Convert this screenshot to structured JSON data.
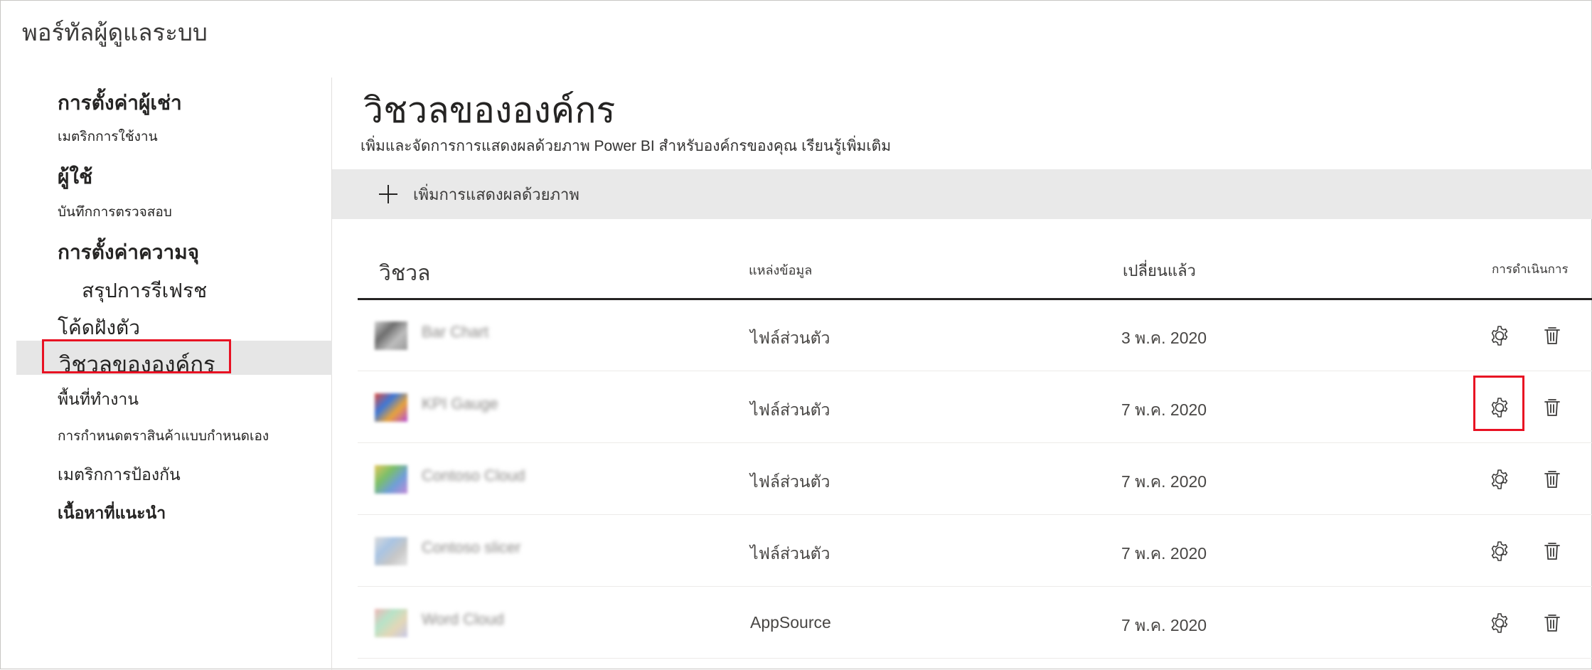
{
  "app": {
    "title": "พอร์ทัลผู้ดูแลระบบ"
  },
  "sidebar": {
    "items": [
      {
        "label": "การตั้งค่าผู้เช่า"
      },
      {
        "label": "เมตริกการใช้งาน"
      },
      {
        "label": "ผู้ใช้"
      },
      {
        "label": "บันทึกการตรวจสอบ"
      },
      {
        "label": "การตั้งค่าความจุ"
      },
      {
        "label": "สรุปการรีเฟรช"
      },
      {
        "label": "โค้ดฝังตัว"
      },
      {
        "label": "วิชวลขององค์กร",
        "selected": true
      },
      {
        "label": "พื้นที่ทำงาน"
      },
      {
        "label": "การกำหนดตราสินค้าแบบกำหนดเอง"
      },
      {
        "label": "เมตริกการป้องกัน"
      },
      {
        "label": "เนื้อหาที่แนะนำ"
      }
    ]
  },
  "main": {
    "title": "วิชวลขององค์กร",
    "description": "เพิ่มและจัดการการแสดงผลด้วยภาพ Power BI สำหรับองค์กรของคุณ เรียนรู้เพิ่มเติม",
    "add_button_label": "เพิ่มการแสดงผลด้วยภาพ"
  },
  "table": {
    "columns": {
      "visual": "วิชวล",
      "source": "แหล่งข้อมูล",
      "changed": "เปลี่ยนแล้ว",
      "actions": "การดำเนินการ"
    },
    "rows": [
      {
        "name": "Bar Chart",
        "source": "ไฟล์ส่วนตัว",
        "changed": "3 พ.ค. 2020",
        "thumb_colors": [
          "#d0d0d0",
          "#6e6e6e",
          "#bdbdbd",
          "#9a9a9a"
        ]
      },
      {
        "name": "KPI Gauge",
        "source": "ไฟล์ส่วนตัว",
        "changed": "7 พ.ค. 2020",
        "thumb_colors": [
          "#e04b3c",
          "#3c78d8",
          "#e8a33c",
          "#b64bd8"
        ]
      },
      {
        "name": "Contoso Cloud",
        "source": "ไฟล์ส่วนตัว",
        "changed": "7 พ.ค. 2020",
        "thumb_colors": [
          "#e3c65a",
          "#7bbf6a",
          "#6f9fd8",
          "#c28ad8"
        ]
      },
      {
        "name": "Contoso slicer",
        "source": "ไฟล์ส่วนตัว",
        "changed": "7 พ.ค. 2020",
        "thumb_colors": [
          "#dcdcdc",
          "#a9c4e3",
          "#c7c7c7",
          "#e6e6e6"
        ]
      },
      {
        "name": "Word Cloud",
        "source": "AppSource",
        "changed": "7 พ.ค. 2020",
        "thumb_colors": [
          "#f0b7b7",
          "#b7e3c8",
          "#e3d7b7",
          "#c8c8e8"
        ]
      }
    ]
  },
  "icons": {
    "settings": "gear-icon",
    "delete": "trash-icon",
    "add": "plus-icon"
  },
  "colors": {
    "highlight": "#e81123",
    "selected_bg": "#e6e6e6",
    "toolbar_bg": "#e9e9e9"
  }
}
